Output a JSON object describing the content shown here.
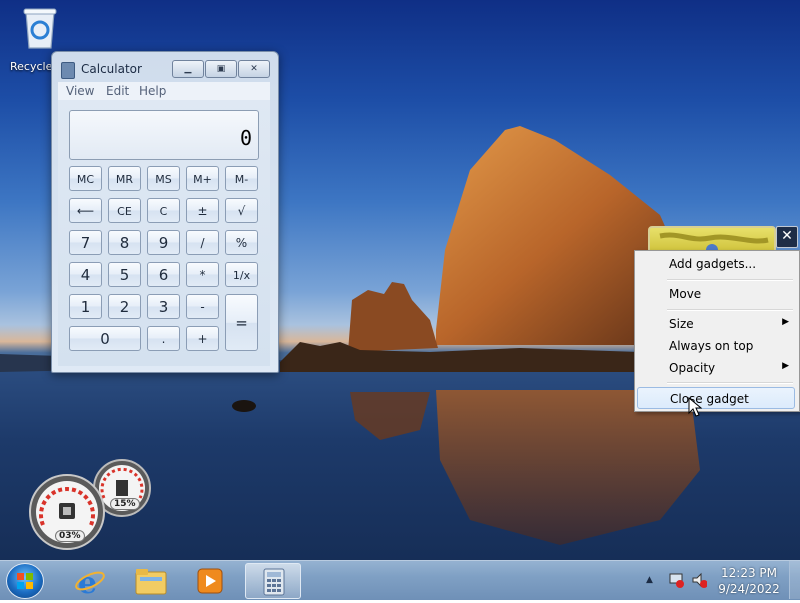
{
  "desktop": {
    "icons": [
      {
        "label": "Recycle Bin",
        "icon": "recycle-bin-icon"
      }
    ]
  },
  "calculator": {
    "title": "Calculator",
    "menu": [
      "View",
      "Edit",
      "Help"
    ],
    "display": "0",
    "buttons": {
      "mc": "MC",
      "mr": "MR",
      "ms": "MS",
      "mplus": "M+",
      "mminus": "M-",
      "back": "⟵",
      "ce": "CE",
      "c": "C",
      "plusminus": "±",
      "sqrt": "√",
      "d7": "7",
      "d8": "8",
      "d9": "9",
      "div": "/",
      "pct": "%",
      "d4": "4",
      "d5": "5",
      "d6": "6",
      "mul": "*",
      "recip": "1/x",
      "d1": "1",
      "d2": "2",
      "d3": "3",
      "minus": "-",
      "equals": "=",
      "d0": "0",
      "dot": ".",
      "plus": "+"
    }
  },
  "gadgets": {
    "cpu_meter": {
      "label": "03%",
      "value_percent": 3
    },
    "ram_meter": {
      "label": "15%",
      "value_percent": 15
    },
    "close_glyph": "✕"
  },
  "context_menu": {
    "items": [
      {
        "label": "Add gadgets..."
      },
      {
        "label": "Move"
      },
      {
        "label": "Size",
        "submenu_arrow": "▶"
      },
      {
        "label": "Always on top"
      },
      {
        "label": "Opacity",
        "submenu_arrow": "▶"
      },
      {
        "label": "Close gadget"
      }
    ],
    "highlighted": "Close gadget"
  },
  "taskbar": {
    "pinned": [
      "start-orb-icon",
      "internet-explorer-icon",
      "windows-explorer-icon",
      "media-player-icon",
      "calculator-icon"
    ],
    "tray_arrow": "▲",
    "clock": {
      "time": "12:23 PM",
      "date": "9/24/2022"
    }
  }
}
